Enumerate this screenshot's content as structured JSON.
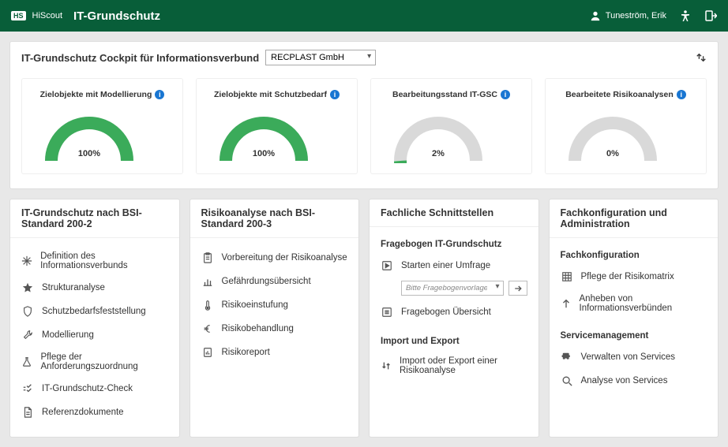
{
  "header": {
    "brand": "HiScout",
    "title": "IT-Grundschutz",
    "user": "Tuneström, Erik"
  },
  "cockpit": {
    "title": "IT-Grundschutz Cockpit für Informationsverbund",
    "selected_org": "RECPLAST GmbH"
  },
  "gauges": [
    {
      "label": "Zielobjekte mit Modellierung",
      "value": 100,
      "display": "100%",
      "color": "#3bab5a"
    },
    {
      "label": "Zielobjekte mit Schutzbedarf",
      "value": 100,
      "display": "100%",
      "color": "#3bab5a"
    },
    {
      "label": "Bearbeitungsstand IT-GSC",
      "value": 2,
      "display": "2%",
      "color": "#3bab5a"
    },
    {
      "label": "Bearbeitete Risikoanalysen",
      "value": 0,
      "display": "0%",
      "color": "#3bab5a"
    }
  ],
  "panels": {
    "p1": {
      "title": "IT-Grundschutz nach BSI-Standard 200-2",
      "items": [
        {
          "icon": "snowflake",
          "label": "Definition des Informationsverbunds"
        },
        {
          "icon": "star",
          "label": "Strukturanalyse"
        },
        {
          "icon": "shield",
          "label": "Schutzbedarfsfeststellung"
        },
        {
          "icon": "wrench",
          "label": "Modellierung"
        },
        {
          "icon": "flask",
          "label": "Pflege der Anforderungszuordnung"
        },
        {
          "icon": "check",
          "label": "IT-Grundschutz-Check"
        },
        {
          "icon": "doc",
          "label": "Referenzdokumente"
        }
      ]
    },
    "p2": {
      "title": "Risikoanalyse nach BSI-Standard 200-3",
      "items": [
        {
          "icon": "clipboard",
          "label": "Vorbereitung der Risikoanalyse"
        },
        {
          "icon": "chart",
          "label": "Gefährdungsübersicht"
        },
        {
          "icon": "thermo",
          "label": "Risikoeinstufung"
        },
        {
          "icon": "euro",
          "label": "Risikobehandlung"
        },
        {
          "icon": "report",
          "label": "Risikoreport"
        }
      ]
    },
    "p3": {
      "title": "Fachliche Schnittstellen",
      "sec1_title": "Fragebogen IT-Grundschutz",
      "start_survey": "Starten einer Umfrage",
      "survey_placeholder": "Bitte Fragebogenvorlage wählen",
      "overview": "Fragebogen Übersicht",
      "sec2_title": "Import und Export",
      "import_export": "Import oder Export einer Risikoanalyse"
    },
    "p4": {
      "title": "Fachkonfiguration und Administration",
      "sec1_title": "Fachkonfiguration",
      "items1": [
        {
          "icon": "grid",
          "label": "Pflege der Risikomatrix"
        },
        {
          "icon": "up",
          "label": "Anheben von Informationsverbünden"
        }
      ],
      "sec2_title": "Servicemanagement",
      "items2": [
        {
          "icon": "puzzle",
          "label": "Verwalten von Services"
        },
        {
          "icon": "search",
          "label": "Analyse von Services"
        }
      ]
    }
  },
  "chart_data": [
    {
      "type": "gauge",
      "title": "Zielobjekte mit Modellierung",
      "value": 100,
      "min": 0,
      "max": 100,
      "unit": "%"
    },
    {
      "type": "gauge",
      "title": "Zielobjekte mit Schutzbedarf",
      "value": 100,
      "min": 0,
      "max": 100,
      "unit": "%"
    },
    {
      "type": "gauge",
      "title": "Bearbeitungsstand IT-GSC",
      "value": 2,
      "min": 0,
      "max": 100,
      "unit": "%"
    },
    {
      "type": "gauge",
      "title": "Bearbeitete Risikoanalysen",
      "value": 0,
      "min": 0,
      "max": 100,
      "unit": "%"
    }
  ]
}
